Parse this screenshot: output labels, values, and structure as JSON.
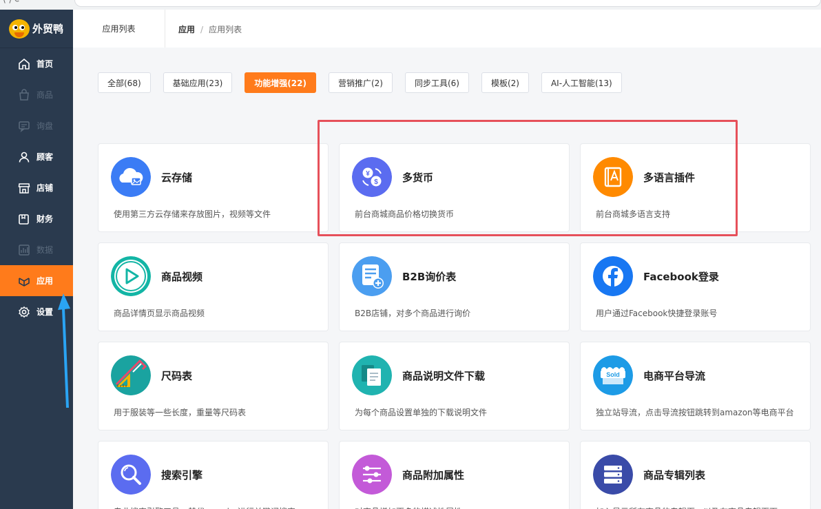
{
  "brand": {
    "name": "外贸鸭"
  },
  "sidebar": {
    "items": [
      {
        "label": "首页",
        "icon": "home-icon",
        "state": "normal"
      },
      {
        "label": "商品",
        "icon": "bag-icon",
        "state": "disabled"
      },
      {
        "label": "询盘",
        "icon": "message-icon",
        "state": "disabled"
      },
      {
        "label": "顾客",
        "icon": "user-icon",
        "state": "normal"
      },
      {
        "label": "店铺",
        "icon": "store-icon",
        "state": "normal"
      },
      {
        "label": "财务",
        "icon": "wallet-icon",
        "state": "normal"
      },
      {
        "label": "数据",
        "icon": "chart-icon",
        "state": "disabled"
      },
      {
        "label": "应用",
        "icon": "apps-icon",
        "state": "active"
      },
      {
        "label": "设置",
        "icon": "gear-icon",
        "state": "normal"
      }
    ]
  },
  "header": {
    "tab": "应用列表",
    "breadcrumb": {
      "root": "应用",
      "current": "应用列表"
    }
  },
  "filters": [
    {
      "label": "全部(68)",
      "active": false
    },
    {
      "label": "基础应用(23)",
      "active": false
    },
    {
      "label": "功能增强(22)",
      "active": true
    },
    {
      "label": "营销推广(2)",
      "active": false
    },
    {
      "label": "同步工具(6)",
      "active": false
    },
    {
      "label": "模板(2)",
      "active": false
    },
    {
      "label": "AI-人工智能(13)",
      "active": false
    }
  ],
  "apps": [
    {
      "title": "云存储",
      "desc": "使用第三方云存储来存放图片，视频等文件",
      "icon": "cloud-storage-icon",
      "color": "#3b7cf5"
    },
    {
      "title": "多货币",
      "desc": "前台商城商品价格切换货币",
      "icon": "currency-icon",
      "color": "#5b6cf0"
    },
    {
      "title": "多语言插件",
      "desc": "前台商城多语言支持",
      "icon": "language-icon",
      "color": "#ff8a00"
    },
    {
      "title": "商品视频",
      "desc": "商品详情页显示商品视频",
      "icon": "play-icon",
      "color": "#13b5a5"
    },
    {
      "title": "B2B询价表",
      "desc": "B2B店铺，对多个商品进行询价",
      "icon": "inquiry-form-icon",
      "color": "#4b9ef0"
    },
    {
      "title": "Facebook登录",
      "desc": "用户通过Facebook快捷登录账号",
      "icon": "facebook-icon",
      "color": "#1877f2"
    },
    {
      "title": "尺码表",
      "desc": "用于服装等一些长度，重量等尺码表",
      "icon": "ruler-icon",
      "color": "#1aa3a0"
    },
    {
      "title": "商品说明文件下载",
      "desc": "为每个商品设置单独的下载说明文件",
      "icon": "document-icon",
      "color": "#20b3b0"
    },
    {
      "title": "电商平台导流",
      "desc": "独立站导流，点击导流按钮跳转到amazon等电商平台",
      "icon": "sold-store-icon",
      "color": "#1d9be6"
    },
    {
      "title": "搜索引擎",
      "desc": "专业搜索引擎工具，替代mysql，进行关键词搜索",
      "icon": "search-icon",
      "color": "#5b6cf0"
    },
    {
      "title": "商品附加属性",
      "desc": "对商品增加更多的描述性属性",
      "icon": "sliders-icon",
      "color": "#c35ad8"
    },
    {
      "title": "商品专辑列表",
      "desc": "加入显示所有商品的专辑页，以及在商品专辑页面",
      "icon": "server-list-icon",
      "color": "#3a4ba8"
    }
  ]
}
